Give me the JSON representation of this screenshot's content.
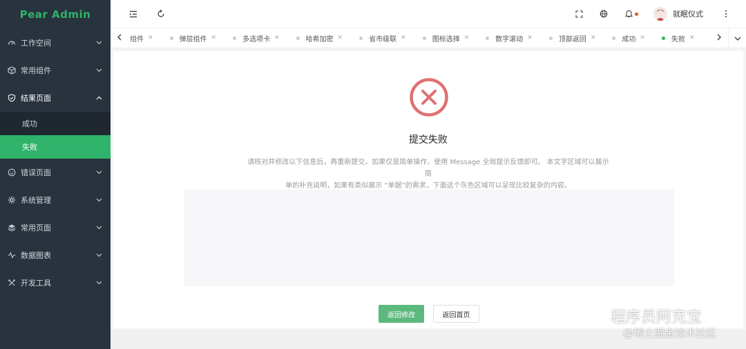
{
  "app": {
    "title": "Pear Admin"
  },
  "sidebar": {
    "items": [
      {
        "label": "工作空间",
        "icon": "dashboard-icon"
      },
      {
        "label": "常用组件",
        "icon": "box-icon"
      },
      {
        "label": "结果页面",
        "icon": "shield-check-icon",
        "open": true,
        "children": [
          {
            "label": "成功"
          },
          {
            "label": "失败",
            "active": true
          }
        ]
      },
      {
        "label": "错误页面",
        "icon": "sad-face-icon"
      },
      {
        "label": "系统管理",
        "icon": "gear-icon"
      },
      {
        "label": "常用页面",
        "icon": "layers-icon"
      },
      {
        "label": "数据图表",
        "icon": "pulse-icon"
      },
      {
        "label": "开发工具",
        "icon": "tools-icon"
      }
    ]
  },
  "header": {
    "user_name": "就眠仪式"
  },
  "tabs": [
    {
      "label": "组件",
      "partial": true
    },
    {
      "label": "弹层组件"
    },
    {
      "label": "多选项卡"
    },
    {
      "label": "哈希加密"
    },
    {
      "label": "省市级联"
    },
    {
      "label": "图标选择"
    },
    {
      "label": "数字滚动"
    },
    {
      "label": "顶部返回"
    },
    {
      "label": "成功"
    },
    {
      "label": "失败",
      "active": true
    }
  ],
  "result": {
    "title": "提交失败",
    "desc_line1": "请核对并修改以下信息后，再重新提交。如果仅是简单操作，使用 Message 全局提示反馈即可。 本文字区域可以展示简",
    "desc_line2": "单的补充说明，如果有类似展示 “单据”的需求，下面这个灰色区域可以呈现比较复杂的内容。",
    "btn_primary": "返回修改",
    "btn_default": "返回首页",
    "status_color": "#e07070"
  },
  "watermark": {
    "line1": "程序员阿克宝",
    "line2": "@稀土掘金技术社区"
  },
  "colors": {
    "accent": "#2fb36a",
    "sidebar_bg": "#28333e"
  }
}
